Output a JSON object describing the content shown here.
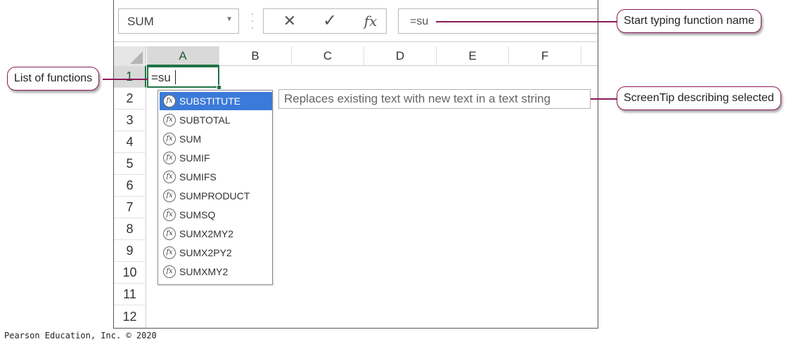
{
  "formula_bar": {
    "name_box": "SUM",
    "cancel_icon": "close-icon",
    "enter_icon": "checkmark-icon",
    "function_icon": "fx-icon",
    "cancel_symbol": "✕",
    "enter_symbol": "✓",
    "function_symbol": "fx",
    "formula_text": "=su"
  },
  "columns": [
    "A",
    "B",
    "C",
    "D",
    "E",
    "F"
  ],
  "rows": [
    "1",
    "2",
    "3",
    "4",
    "5",
    "6",
    "7",
    "8",
    "9",
    "10",
    "11",
    "12"
  ],
  "active_cell": {
    "ref": "A1",
    "value": "=su"
  },
  "autocomplete": {
    "items": [
      {
        "label": "SUBSTITUTE",
        "selected": true
      },
      {
        "label": "SUBTOTAL"
      },
      {
        "label": "SUM"
      },
      {
        "label": "SUMIF"
      },
      {
        "label": "SUMIFS"
      },
      {
        "label": "SUMPRODUCT"
      },
      {
        "label": "SUMSQ"
      },
      {
        "label": "SUMX2MY2"
      },
      {
        "label": "SUMX2PY2"
      },
      {
        "label": "SUMXMY2"
      }
    ],
    "item_icon_symbol": "fx"
  },
  "screen_tip": "Replaces existing text with new text in a text string",
  "callouts": {
    "start_typing": "Start typing function name",
    "list_of_functions": "List of functions",
    "screentip": "ScreenTip describing selected"
  },
  "credit": "Pearson Education, Inc. © 2020",
  "colors": {
    "accent_green": "#217346",
    "selection_blue": "#3b7ad9",
    "callout_border": "#8c1a58"
  }
}
